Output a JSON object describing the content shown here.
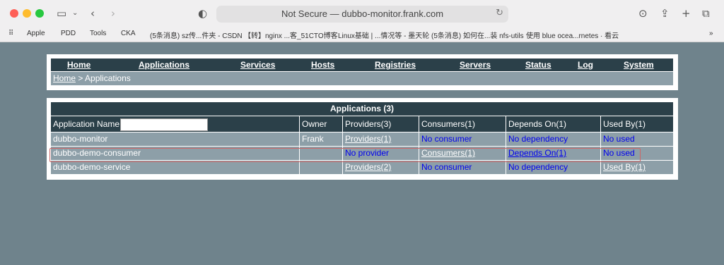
{
  "browser": {
    "url": "Not Secure — dubbo-monitor.frank.com",
    "bookmarks": [
      "Apple",
      "PDD",
      "Tools",
      "CKA",
      "(5条消息) sz传...件夹 - CSDN",
      "【转】nginx ...客_51CTO博客",
      "Linux基础 | ...情况等 - 墨天轮",
      "(5条消息) 如何在...装 nfs-utils",
      "使用 blue ocea...rnetes · 看云"
    ]
  },
  "nav": {
    "items": [
      "Home",
      "Applications",
      "Services",
      "Hosts",
      "Registries",
      "Servers",
      "Status",
      "Log",
      "System"
    ]
  },
  "breadcrumb": {
    "home": "Home",
    "sep": " > ",
    "current": "Applications"
  },
  "apps": {
    "title": "Applications (3)",
    "columns": [
      "Application Name:",
      "Owner",
      "Providers(3)",
      "Consumers(1)",
      "Depends On(1)",
      "Used By(1)"
    ],
    "rows": [
      {
        "name": "dubbo-monitor",
        "owner": "Frank",
        "providers": "Providers(1)",
        "consumers": "No consumer",
        "depends": "No dependency",
        "usedby": "No used"
      },
      {
        "name": "dubbo-demo-consumer",
        "owner": "",
        "providers": "No provider",
        "consumers": "Consumers(1)",
        "depends": "Depends On(1)",
        "usedby": "No used"
      },
      {
        "name": "dubbo-demo-service",
        "owner": "",
        "providers": "Providers(2)",
        "consumers": "No consumer",
        "depends": "No dependency",
        "usedby": "Used By(1)"
      }
    ]
  }
}
